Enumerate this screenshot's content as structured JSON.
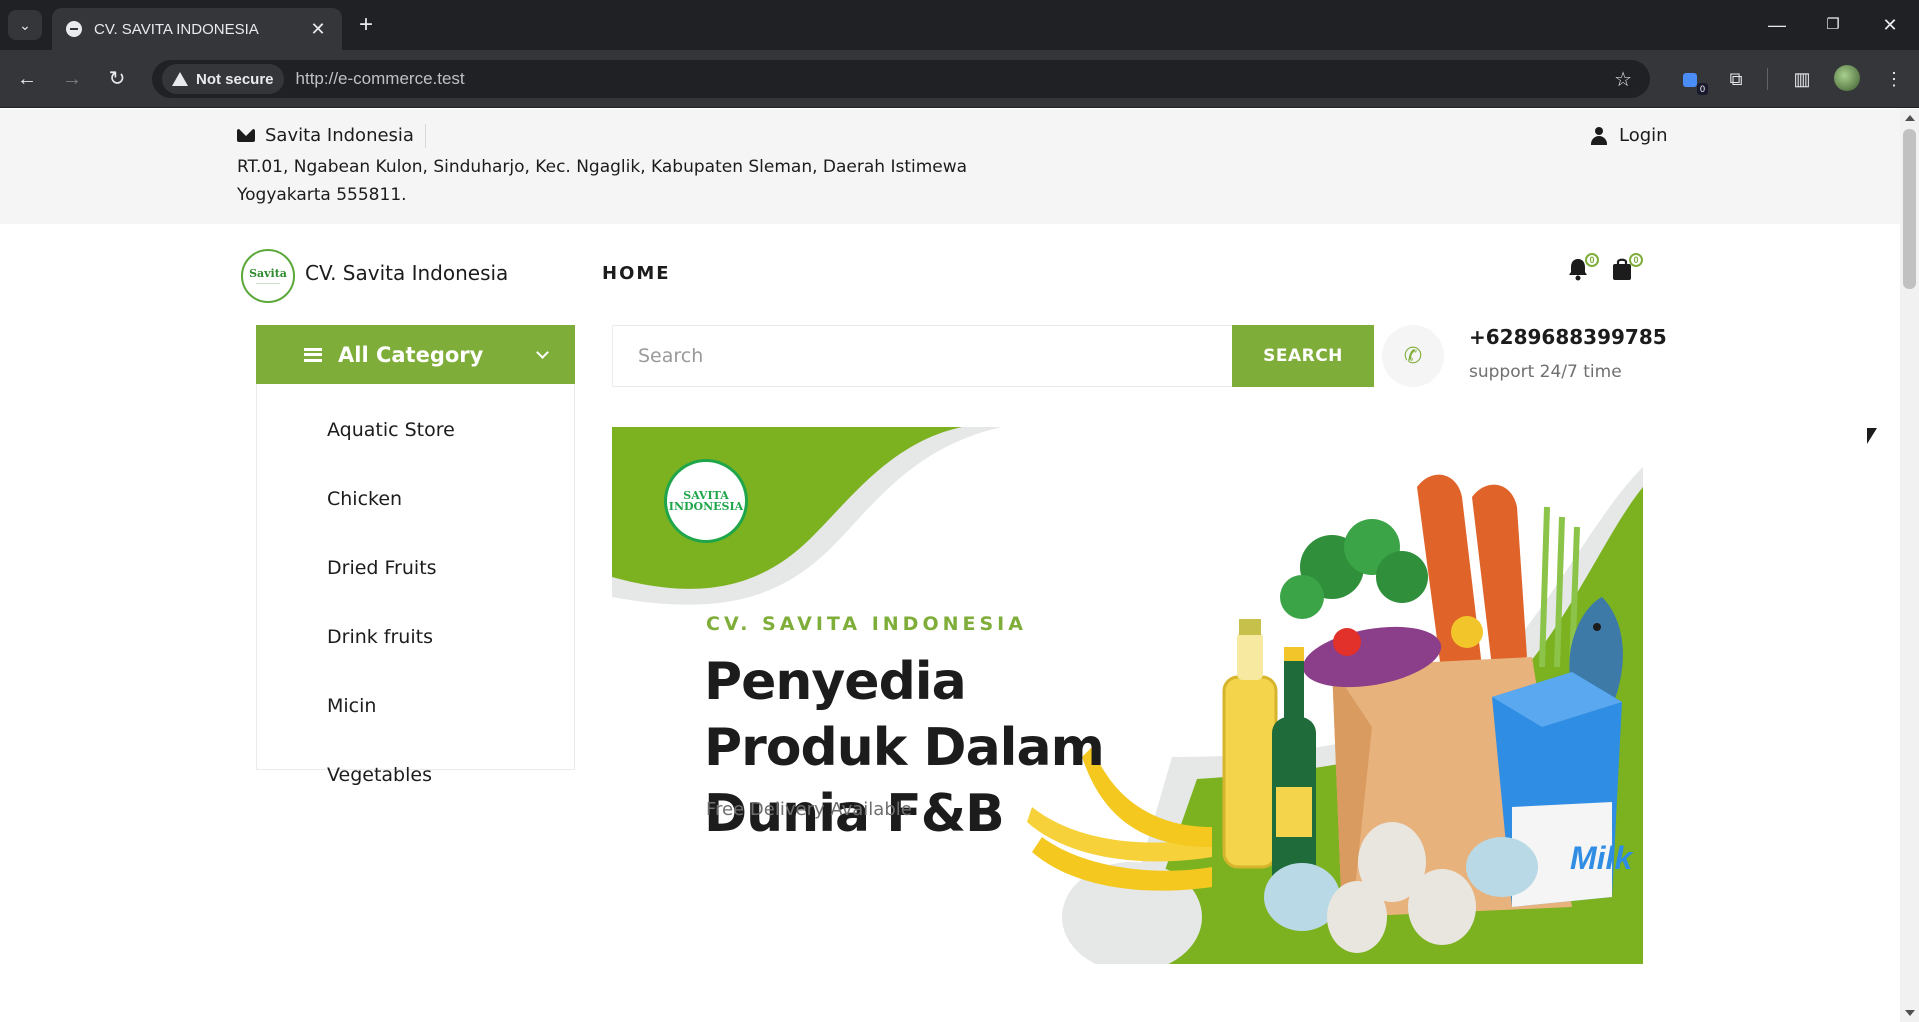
{
  "browser": {
    "tab_title": "CV. SAVITA INDONESIA",
    "security_label": "Not secure",
    "url": "http://e-commerce.test",
    "extension_badge": "0",
    "icons": {
      "tab_search": "chevron-down-icon",
      "close": "close-icon",
      "new_tab": "plus-icon",
      "back": "arrow-left-icon",
      "forward": "arrow-right-icon",
      "reload": "reload-icon",
      "bookmark": "star-icon",
      "extensions": "puzzle-icon",
      "side_panel": "side-panel-icon",
      "menu": "kebab-menu-icon"
    }
  },
  "topbar": {
    "email_label": "Savita Indonesia",
    "address": "RT.01, Ngabean Kulon, Sinduharjo, Kec. Ngaglik, Kabupaten Sleman, Daerah Istimewa Yogyakarta 555811.",
    "login_label": "Login"
  },
  "header": {
    "brand_logo_text": "Savita",
    "brand_name": "CV. Savita Indonesia",
    "nav_home": "HOME",
    "notification_count": "0",
    "cart_count": "0"
  },
  "categories": {
    "title": "All Category",
    "items": [
      {
        "label": "Aquatic Store"
      },
      {
        "label": "Chicken"
      },
      {
        "label": "Dried Fruits"
      },
      {
        "label": "Drink fruits"
      },
      {
        "label": "Micin"
      },
      {
        "label": "Vegetables"
      }
    ]
  },
  "search": {
    "placeholder": "Search",
    "button_label": "SEARCH"
  },
  "contact": {
    "phone": "+6289688399785",
    "support": "support 24/7 time"
  },
  "hero": {
    "logo_line1": "SAVITA",
    "logo_line2": "INDONESIA",
    "tagline": "CV. SAVITA INDONESIA",
    "title": "Penyedia Produk Dalam Dunia F&B",
    "subtitle": "Free Delivery Available",
    "milk_label": "Milk"
  },
  "colors": {
    "accent": "#7fad39",
    "text": "#1c1c1c",
    "browser_dark": "#202124",
    "browser_toolbar": "#35363a"
  }
}
